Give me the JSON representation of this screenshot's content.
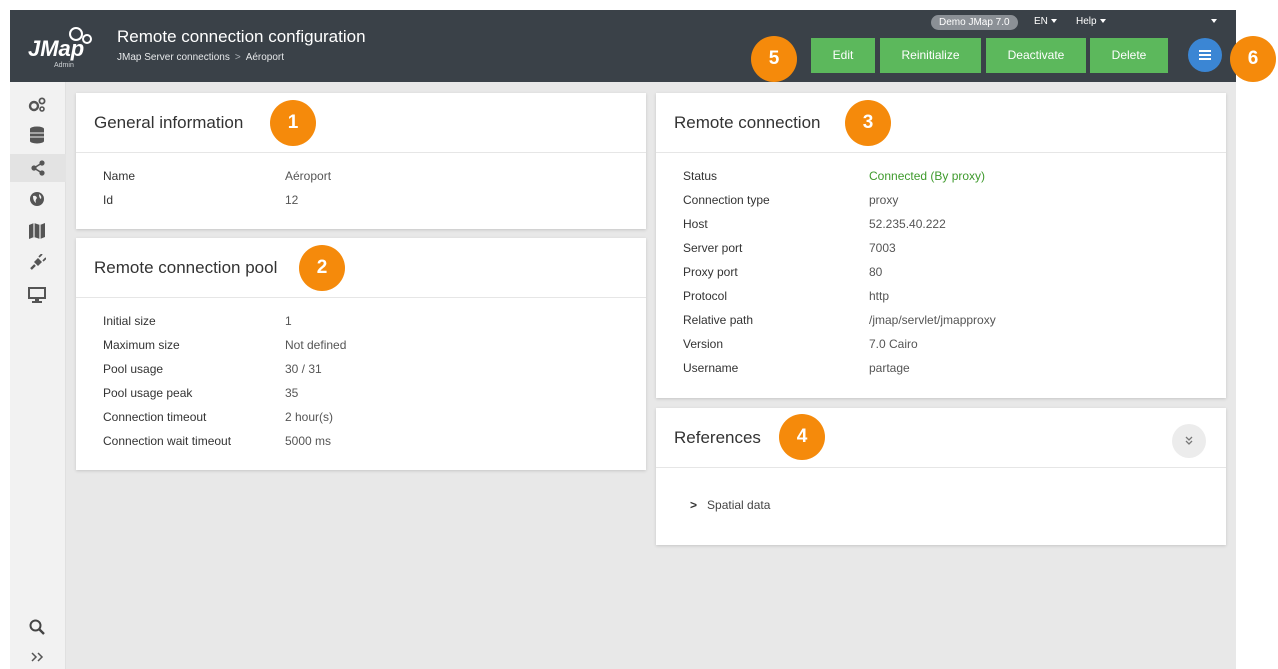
{
  "app": {
    "logo_text": "JMap",
    "logo_sub": "Admin",
    "title": "Remote connection configuration",
    "breadcrumb": [
      "JMap Server connections",
      "Aéroport"
    ],
    "demo_badge": "Demo JMap 7.0",
    "lang": "EN",
    "help": "Help"
  },
  "toolbar": {
    "edit": "Edit",
    "reinitialize": "Reinitialize",
    "deactivate": "Deactivate",
    "delete": "Delete",
    "button_color": "#5cb85c"
  },
  "callouts": [
    "1",
    "2",
    "3",
    "4",
    "5",
    "6"
  ],
  "sidebar": {
    "items": [
      "services-icon",
      "database-icon",
      "share-icon",
      "globe-icon",
      "map-icon",
      "plugin-icon",
      "monitor-icon",
      "search-icon",
      "expand-icon"
    ]
  },
  "general": {
    "title": "General information",
    "rows": [
      {
        "k": "Name",
        "v": "Aéroport"
      },
      {
        "k": "Id",
        "v": "12"
      }
    ]
  },
  "pool": {
    "title": "Remote connection pool",
    "rows": [
      {
        "k": "Initial size",
        "v": "1"
      },
      {
        "k": "Maximum size",
        "v": "Not defined"
      },
      {
        "k": "Pool usage",
        "v": "30 / 31"
      },
      {
        "k": "Pool usage peak",
        "v": "35"
      },
      {
        "k": "Connection timeout",
        "v": "2 hour(s)"
      },
      {
        "k": "Connection wait timeout",
        "v": "5000 ms"
      }
    ]
  },
  "remote": {
    "title": "Remote connection",
    "rows": [
      {
        "k": "Status",
        "v": "Connected (By proxy)"
      },
      {
        "k": "Connection type",
        "v": "proxy"
      },
      {
        "k": "Host",
        "v": "52.235.40.222"
      },
      {
        "k": "Server port",
        "v": "7003"
      },
      {
        "k": "Proxy port",
        "v": "80"
      },
      {
        "k": "Protocol",
        "v": "http"
      },
      {
        "k": "Relative path",
        "v": "/jmap/servlet/jmapproxy"
      },
      {
        "k": "Version",
        "v": "7.0 Cairo"
      },
      {
        "k": "Username",
        "v": "partage"
      }
    ],
    "status_color": "#3e9a2c"
  },
  "references": {
    "title": "References",
    "items": [
      "Spatial data"
    ]
  }
}
